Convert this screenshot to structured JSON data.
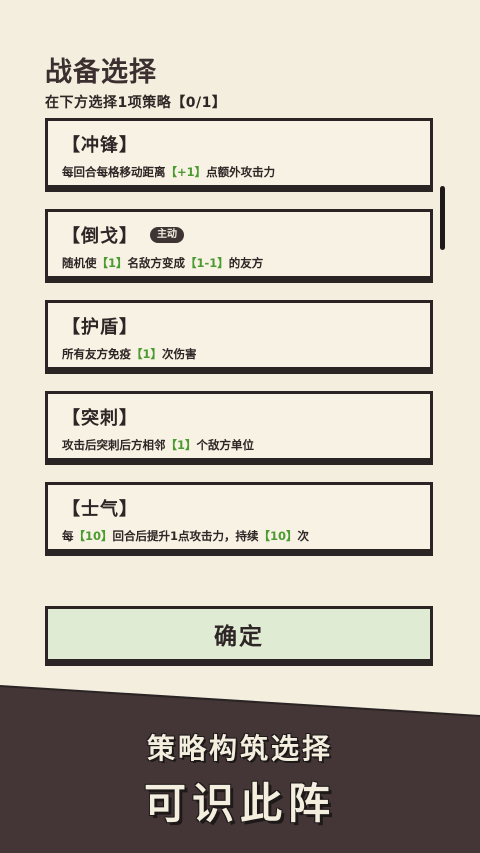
{
  "header": {
    "title": "战备选择",
    "subtitle": "在下方选择1项策略【0/1】"
  },
  "cards": [
    {
      "title": "【冲锋】",
      "badge": "",
      "desc": [
        "每回合每格移动距离",
        "【+1】",
        "点额外攻击力"
      ]
    },
    {
      "title": "【倒戈】",
      "badge": "主动",
      "desc": [
        "随机使",
        "【1】",
        "名敌方变成",
        "【1-1】",
        "的友方"
      ]
    },
    {
      "title": "【护盾】",
      "badge": "",
      "desc": [
        "所有友方免疫",
        "【1】",
        "次伤害"
      ]
    },
    {
      "title": "【突刺】",
      "badge": "",
      "desc": [
        "攻击后突刺后方相邻",
        "【1】",
        "个敌方单位"
      ]
    },
    {
      "title": "【士气】",
      "badge": "",
      "desc": [
        "每",
        "【10】",
        "回合后提升1点攻击力，持续",
        "【10】",
        "次"
      ]
    }
  ],
  "confirm_label": "确定",
  "promo": {
    "line1": "策略构筑选择",
    "line2": "可识此阵"
  },
  "colors": {
    "background": "#f3eedd",
    "ink": "#2b2424",
    "highlight": "#4c9a32",
    "confirm_bg": "#dfecd3",
    "footer_bg": "#443636"
  }
}
